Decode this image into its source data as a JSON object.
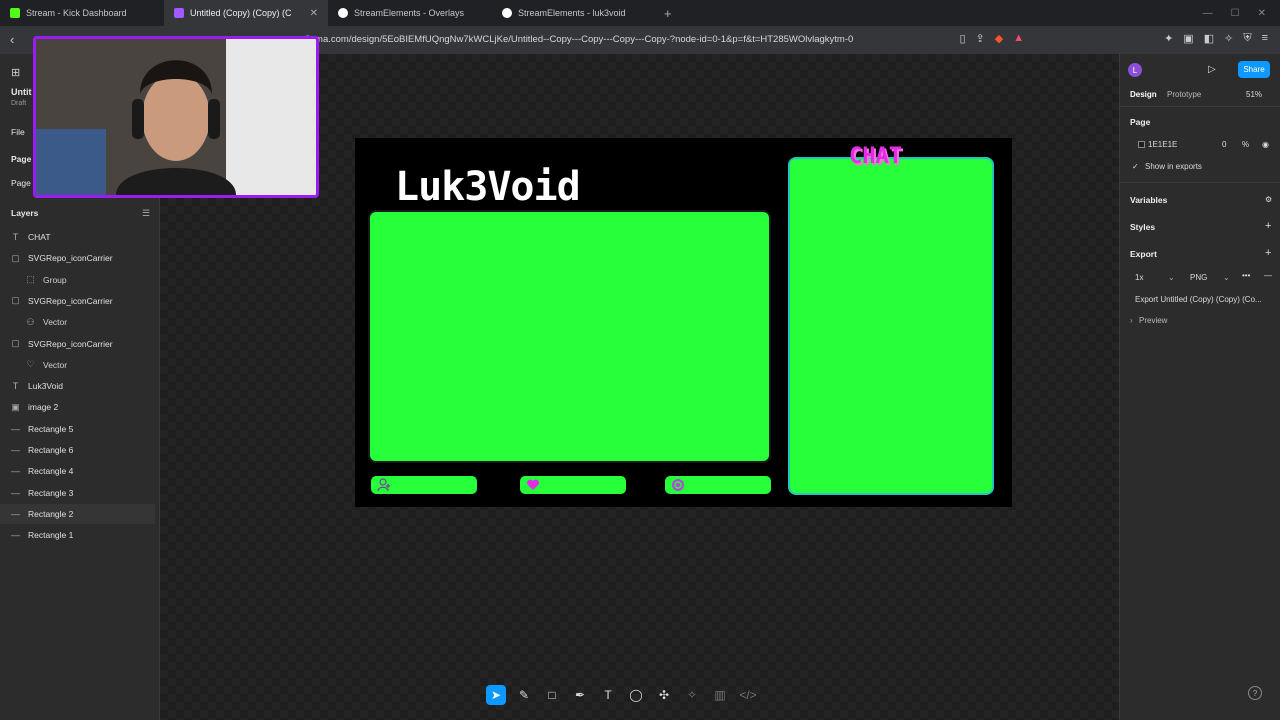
{
  "tabs": [
    {
      "label": "Stream - Kick Dashboard",
      "color": "#53fc18"
    },
    {
      "label": "Untitled (Copy) (Copy) (C",
      "color": "#a259ff"
    },
    {
      "label": "StreamElements - Overlays",
      "color": "#ffffff"
    },
    {
      "label": "StreamElements - luk3void",
      "color": "#ffffff"
    }
  ],
  "url": "figma.com/design/5EoBIEMfUQngNw7kWCLjKe/Untitled--Copy---Copy---Copy---Copy-?node-id=0-1&p=f&t=HT285WOlvlagkytm-0",
  "left": {
    "file_name": "Untit",
    "drafts": "Draft",
    "file_menu": "File",
    "pages_label": "Page",
    "page1": "Page 1",
    "layers_title": "Layers",
    "layers": [
      {
        "label": "CHAT",
        "icon": "text-icon",
        "sub": false
      },
      {
        "label": "SVGRepo_iconCarrier",
        "icon": "frame-icon",
        "sub": false
      },
      {
        "label": "Group",
        "icon": "group-icon",
        "sub": true
      },
      {
        "label": "SVGRepo_iconCarrier",
        "icon": "frame-icon",
        "sub": false
      },
      {
        "label": "Vector",
        "icon": "user-vector-icon",
        "sub": true
      },
      {
        "label": "SVGRepo_iconCarrier",
        "icon": "frame-icon",
        "sub": false
      },
      {
        "label": "Vector",
        "icon": "heart-vector-icon",
        "sub": true
      },
      {
        "label": "Luk3Void",
        "icon": "text-icon",
        "sub": false
      },
      {
        "label": "image 2",
        "icon": "image-icon",
        "sub": false
      },
      {
        "label": "Rectangle 5",
        "icon": "rect-icon",
        "sub": false
      },
      {
        "label": "Rectangle 6",
        "icon": "rect-icon",
        "sub": false
      },
      {
        "label": "Rectangle 4",
        "icon": "rect-icon",
        "sub": false
      },
      {
        "label": "Rectangle 3",
        "icon": "rect-icon",
        "sub": false
      },
      {
        "label": "Rectangle 2",
        "icon": "rect-icon",
        "sub": false
      },
      {
        "label": "Rectangle 1",
        "icon": "rect-icon",
        "sub": false
      }
    ]
  },
  "canvas": {
    "title": "Luk3Void",
    "chat_label": "CHAT",
    "green": "#26ff3a",
    "pink": "#e22ce6",
    "webcam_border": "#9a1cf0"
  },
  "right": {
    "avatar": "L",
    "share": "Share",
    "tab_design": "Design",
    "tab_prototype": "Prototype",
    "zoom": "51%",
    "page_label": "Page",
    "page_color": "1E1E1E",
    "page_opacity": "0",
    "page_opacity_unit": "%",
    "show_in_exports": "Show in exports",
    "variables": "Variables",
    "styles": "Styles",
    "export": "Export",
    "export_scale": "1x",
    "export_format": "PNG",
    "export_button": "Export Untitled (Copy) (Copy) (Co...",
    "preview": "Preview"
  },
  "help": "?"
}
